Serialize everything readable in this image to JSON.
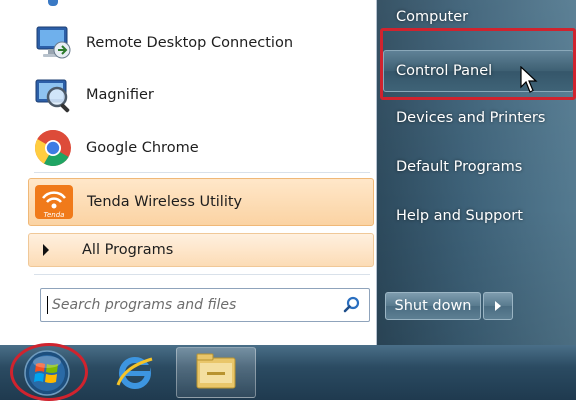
{
  "start_menu": {
    "programs": [
      {
        "label": "Remote Desktop Connection",
        "icon": "remote-desktop-icon"
      },
      {
        "label": "Magnifier",
        "icon": "magnifier-icon"
      },
      {
        "label": "Google Chrome",
        "icon": "chrome-icon"
      },
      {
        "label": "Tenda Wireless Utility",
        "icon": "tenda-icon",
        "highlighted": true,
        "icon_text": "Tenda"
      }
    ],
    "all_programs_label": "All Programs",
    "search_placeholder": "Search programs and files",
    "right_items": [
      {
        "label": "Computer"
      },
      {
        "label": "Control Panel",
        "highlighted": true
      },
      {
        "label": "Devices and Printers"
      },
      {
        "label": "Default Programs"
      },
      {
        "label": "Help and Support"
      }
    ],
    "shutdown_label": "Shut down"
  },
  "taskbar": {
    "pinned": [
      "start-orb-icon",
      "internet-explorer-icon",
      "file-explorer-icon"
    ]
  },
  "colors": {
    "highlight_red": "#d0232e",
    "right_panel": "#3d6178",
    "taskbar": "#2b4b62"
  }
}
